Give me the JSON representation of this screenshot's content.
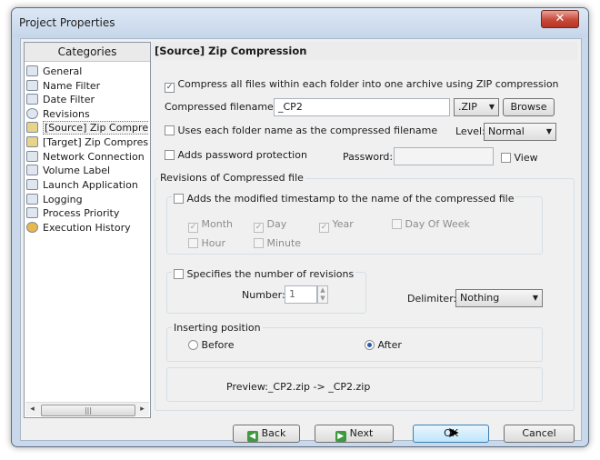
{
  "window": {
    "title": "Project Properties",
    "close_glyph": "✕"
  },
  "categories": {
    "header": "Categories",
    "items": [
      {
        "label": "General",
        "icon": "calendar-icon"
      },
      {
        "label": "Name Filter",
        "icon": "document-icon"
      },
      {
        "label": "Date Filter",
        "icon": "document-icon"
      },
      {
        "label": "Revisions",
        "icon": "clock-icon"
      },
      {
        "label": "[Source] Zip Compression",
        "icon": "zip-icon",
        "selected": true
      },
      {
        "label": "[Target] Zip Compression",
        "icon": "zip-icon"
      },
      {
        "label": "Network Connection",
        "icon": "network-icon"
      },
      {
        "label": "Volume Label",
        "icon": "drive-icon"
      },
      {
        "label": "Launch Application",
        "icon": "launch-icon"
      },
      {
        "label": "Logging",
        "icon": "log-icon"
      },
      {
        "label": "Process Priority",
        "icon": "priority-icon"
      },
      {
        "label": "Execution History",
        "icon": "history-icon"
      }
    ],
    "scroll_left": "◂",
    "scroll_right": "▸",
    "scroll_grip": "|||"
  },
  "section_title": "[Source] Zip Compression",
  "compress_all": {
    "label": "Compress all files within each folder into one archive using ZIP compression",
    "checked": true,
    "mark": "✓"
  },
  "compressed_filename": {
    "label": "Compressed filename:",
    "value": "_CP2",
    "extension": ".ZIP",
    "browse_label": "Browse"
  },
  "use_folder_name": {
    "label": "Uses each folder name as the compressed filename",
    "checked": false
  },
  "level": {
    "label": "Level:",
    "value": "Normal"
  },
  "password_protection": {
    "label": "Adds password protection",
    "checked": false
  },
  "password": {
    "label": "Password:",
    "value": "",
    "view_label": "View"
  },
  "revisions_group": {
    "title": "Revisions of Compressed file",
    "add_timestamp": {
      "label": "Adds the modified timestamp to the name of the compressed file",
      "checked": false
    },
    "timestamp_parts": [
      {
        "label": "Month",
        "checked": true
      },
      {
        "label": "Day",
        "checked": true
      },
      {
        "label": "Year",
        "checked": true
      },
      {
        "label": "Day Of Week",
        "checked": false
      },
      {
        "label": "Hour",
        "checked": false
      },
      {
        "label": "Minute",
        "checked": false
      }
    ],
    "specify_revisions": {
      "label": "Specifies the number of revisions",
      "checked": false
    },
    "number": {
      "label": "Number:",
      "value": "1"
    },
    "delimiter": {
      "label": "Delimiter:",
      "value": "Nothing"
    }
  },
  "inserting_position": {
    "title": "Inserting position",
    "options": [
      {
        "label": "Before",
        "selected": false
      },
      {
        "label": "After",
        "selected": true
      }
    ]
  },
  "preview": {
    "text": "Preview:_CP2.zip -> _CP2.zip"
  },
  "buttons": {
    "back": "Back",
    "next": "Next",
    "ok": "OK",
    "cancel": "Cancel"
  }
}
